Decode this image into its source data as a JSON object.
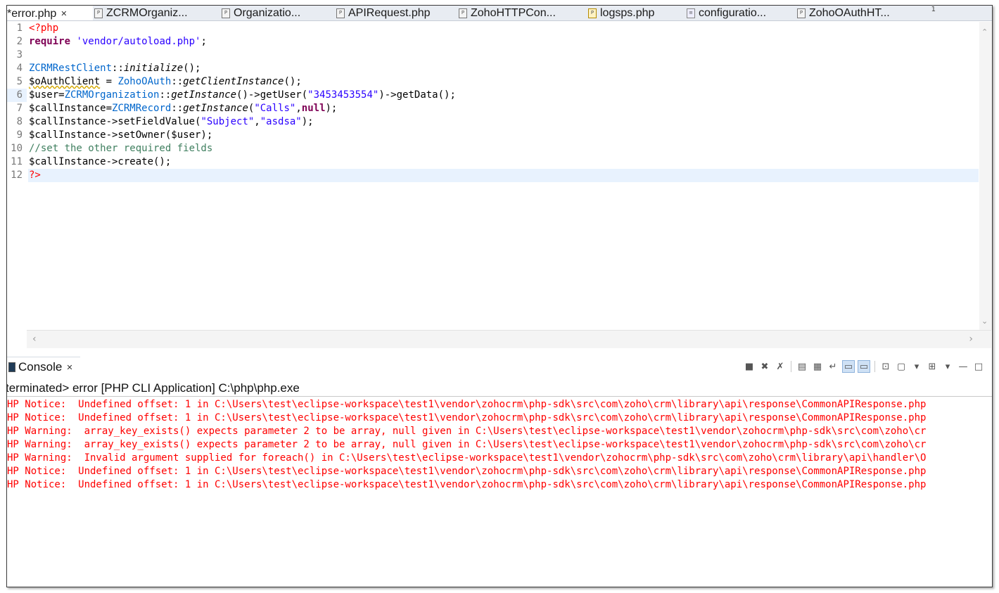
{
  "tabs": [
    {
      "label": "*error.php",
      "icon": "php-file-icon",
      "active": true,
      "closable": true
    },
    {
      "label": "ZCRMOrganiz...",
      "icon": "php-file-icon"
    },
    {
      "label": "Organizatio...",
      "icon": "php-file-icon"
    },
    {
      "label": "APIRequest.php",
      "icon": "php-file-icon"
    },
    {
      "label": "ZohoHTTPCon...",
      "icon": "php-file-icon"
    },
    {
      "label": "logsps.php",
      "icon": "php-warning-file-icon"
    },
    {
      "label": "configuratio...",
      "icon": "config-file-icon"
    },
    {
      "label": "ZohoOAuthHT...",
      "icon": "php-file-icon"
    }
  ],
  "tab_overflow": "1",
  "editor": {
    "line_numbers": [
      "1",
      "2",
      "3",
      "4",
      "5",
      "6",
      "7",
      "8",
      "9",
      "10",
      "11",
      "12"
    ],
    "current_line": 12,
    "code": [
      [
        {
          "t": "<?php",
          "c": "tag"
        }
      ],
      [
        {
          "t": "require",
          "c": "kw"
        },
        {
          "t": " "
        },
        {
          "t": "'vendor/autoload.php'",
          "c": "str"
        },
        {
          "t": ";"
        }
      ],
      [],
      [
        {
          "t": "ZCRMRestClient",
          "c": "cls"
        },
        {
          "t": "::"
        },
        {
          "t": "initialize",
          "c": "mth"
        },
        {
          "t": "();"
        }
      ],
      [
        {
          "t": "$oAuthClient",
          "c": "warnline"
        },
        {
          "t": " = "
        },
        {
          "t": "ZohoOAuth",
          "c": "cls"
        },
        {
          "t": "::"
        },
        {
          "t": "getClientInstance",
          "c": "mth"
        },
        {
          "t": "();"
        }
      ],
      [
        {
          "t": "$user="
        },
        {
          "t": "ZCRMOrganization",
          "c": "cls"
        },
        {
          "t": "::"
        },
        {
          "t": "getInstance",
          "c": "mth"
        },
        {
          "t": "()->getUser("
        },
        {
          "t": "\"3453453554\"",
          "c": "str"
        },
        {
          "t": ")->getData();"
        }
      ],
      [
        {
          "t": "$callInstance="
        },
        {
          "t": "ZCRMRecord",
          "c": "cls"
        },
        {
          "t": "::"
        },
        {
          "t": "getInstance",
          "c": "mth"
        },
        {
          "t": "("
        },
        {
          "t": "\"Calls\"",
          "c": "str"
        },
        {
          "t": ","
        },
        {
          "t": "null",
          "c": "kw"
        },
        {
          "t": ");"
        }
      ],
      [
        {
          "t": "$callInstance->setFieldValue("
        },
        {
          "t": "\"Subject\"",
          "c": "str"
        },
        {
          "t": ","
        },
        {
          "t": "\"asdsa\"",
          "c": "str"
        },
        {
          "t": ");"
        }
      ],
      [
        {
          "t": "$callInstance->setOwner($user);"
        }
      ],
      [
        {
          "t": "//set the other required fields",
          "c": "cmt"
        }
      ],
      [
        {
          "t": "$callInstance->create();"
        }
      ],
      [
        {
          "t": "?>",
          "c": "tag"
        }
      ]
    ]
  },
  "console": {
    "title": "Console",
    "terminated_text": "terminated> error [PHP CLI Application] C:\\php\\php.exe",
    "output": [
      "HP Notice:  Undefined offset: 1 in C:\\Users\\test\\eclipse-workspace\\test1\\vendor\\zohocrm\\php-sdk\\src\\com\\zoho\\crm\\library\\api\\response\\CommonAPIResponse.php",
      "HP Notice:  Undefined offset: 1 in C:\\Users\\test\\eclipse-workspace\\test1\\vendor\\zohocrm\\php-sdk\\src\\com\\zoho\\crm\\library\\api\\response\\CommonAPIResponse.php",
      "HP Warning:  array_key_exists() expects parameter 2 to be array, null given in C:\\Users\\test\\eclipse-workspace\\test1\\vendor\\zohocrm\\php-sdk\\src\\com\\zoho\\cr",
      "HP Warning:  array_key_exists() expects parameter 2 to be array, null given in C:\\Users\\test\\eclipse-workspace\\test1\\vendor\\zohocrm\\php-sdk\\src\\com\\zoho\\cr",
      "HP Warning:  Invalid argument supplied for foreach() in C:\\Users\\test\\eclipse-workspace\\test1\\vendor\\zohocrm\\php-sdk\\src\\com\\zoho\\crm\\library\\api\\handler\\O",
      "HP Notice:  Undefined offset: 1 in C:\\Users\\test\\eclipse-workspace\\test1\\vendor\\zohocrm\\php-sdk\\src\\com\\zoho\\crm\\library\\api\\response\\CommonAPIResponse.php",
      "HP Notice:  Undefined offset: 1 in C:\\Users\\test\\eclipse-workspace\\test1\\vendor\\zohocrm\\php-sdk\\src\\com\\zoho\\crm\\library\\api\\response\\CommonAPIResponse.php"
    ],
    "toolbar": [
      "terminate-icon",
      "remove-launch-icon",
      "remove-all-terminated-icon",
      "separator",
      "clear-console-icon",
      "scroll-lock-icon",
      "word-wrap-icon",
      "show-console-on-stdout-icon",
      "show-console-on-stderr-icon",
      "separator",
      "pin-console-icon",
      "display-selected-console-icon",
      "display-console-dropdown-icon",
      "open-console-icon",
      "open-console-dropdown-icon",
      "minimize-icon",
      "maximize-icon"
    ]
  },
  "colors": {
    "keyword": "#7f0055",
    "string": "#2a00ff",
    "class": "#0066cc",
    "comment": "#3f7f5f",
    "php_tag": "#ff0000",
    "error_output": "#ff0000",
    "current_line": "#e8f2fe"
  }
}
